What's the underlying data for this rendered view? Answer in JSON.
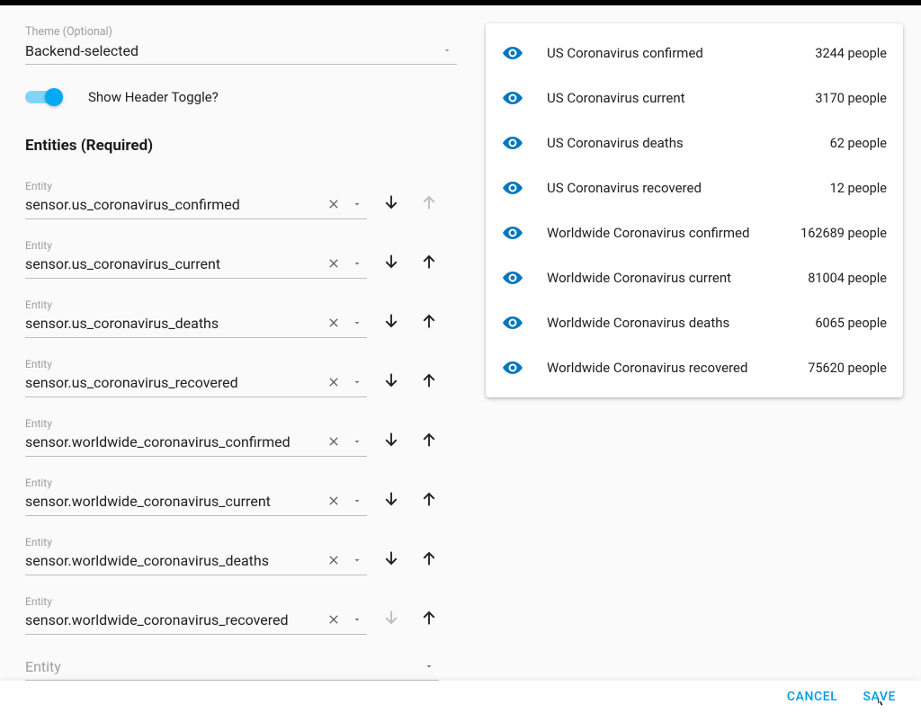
{
  "theme": {
    "label": "Theme (Optional)",
    "value": "Backend-selected"
  },
  "headerToggle": {
    "label": "Show Header Toggle?",
    "on": true
  },
  "entities_section_title": "Entities (Required)",
  "entity_field_label": "Entity",
  "entities": [
    {
      "id": "sensor.us_coronavirus_confirmed"
    },
    {
      "id": "sensor.us_coronavirus_current"
    },
    {
      "id": "sensor.us_coronavirus_deaths"
    },
    {
      "id": "sensor.us_coronavirus_recovered"
    },
    {
      "id": "sensor.worldwide_coronavirus_confirmed"
    },
    {
      "id": "sensor.worldwide_coronavirus_current"
    },
    {
      "id": "sensor.worldwide_coronavirus_deaths"
    },
    {
      "id": "sensor.worldwide_coronavirus_recovered"
    }
  ],
  "new_entity_placeholder": "Entity",
  "preview": [
    {
      "name": "US Coronavirus confirmed",
      "value": "3244 people"
    },
    {
      "name": "US Coronavirus current",
      "value": "3170 people"
    },
    {
      "name": "US Coronavirus deaths",
      "value": "62 people"
    },
    {
      "name": "US Coronavirus recovered",
      "value": "12 people"
    },
    {
      "name": "Worldwide Coronavirus confirmed",
      "value": "162689 people"
    },
    {
      "name": "Worldwide Coronavirus current",
      "value": "81004 people"
    },
    {
      "name": "Worldwide Coronavirus deaths",
      "value": "6065 people"
    },
    {
      "name": "Worldwide Coronavirus recovered",
      "value": "75620 people"
    }
  ],
  "footer": {
    "cancel": "CANCEL",
    "save": "SAVE"
  },
  "icons": {
    "eye_color": "#0277bd"
  }
}
